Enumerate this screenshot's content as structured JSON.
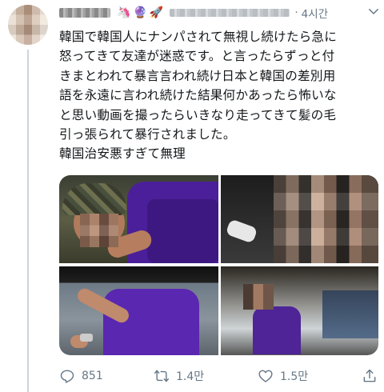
{
  "tweet": {
    "author_display_name_obscured": true,
    "header_emojis": [
      "🦄",
      "🔮",
      "🚀"
    ],
    "separator": "·",
    "time": "4시간",
    "text_lines": [
      "韓国で韓国人にナンパされて無視し続けたら急に",
      "怒ってきて友達が迷惑です。と言ったらずっと付",
      "きまとわれて暴言言われ続け日本と韓国の差別用",
      "語を永遠に言われ続けた結果何かあったら怖いな",
      "と思い動画を撮ったらいきなり走ってきて髪の毛",
      "引っ張られて暴行されました。",
      "韓国治安悪すぎて無理"
    ],
    "media": {
      "photos": [
        {
          "name": "photo-1"
        },
        {
          "name": "photo-2"
        },
        {
          "name": "photo-3"
        },
        {
          "name": "photo-4"
        }
      ]
    },
    "actions": {
      "reply_count": "851",
      "retweet_count": "1.4만",
      "like_count": "1.5만"
    }
  },
  "icons": {
    "menu": "chevron-down-icon",
    "reply": "reply-icon",
    "retweet": "retweet-icon",
    "like": "heart-icon",
    "share": "share-icon"
  },
  "colors": {
    "text": "#14171a",
    "muted": "#657786",
    "thread_line": "#ccd6dd"
  }
}
